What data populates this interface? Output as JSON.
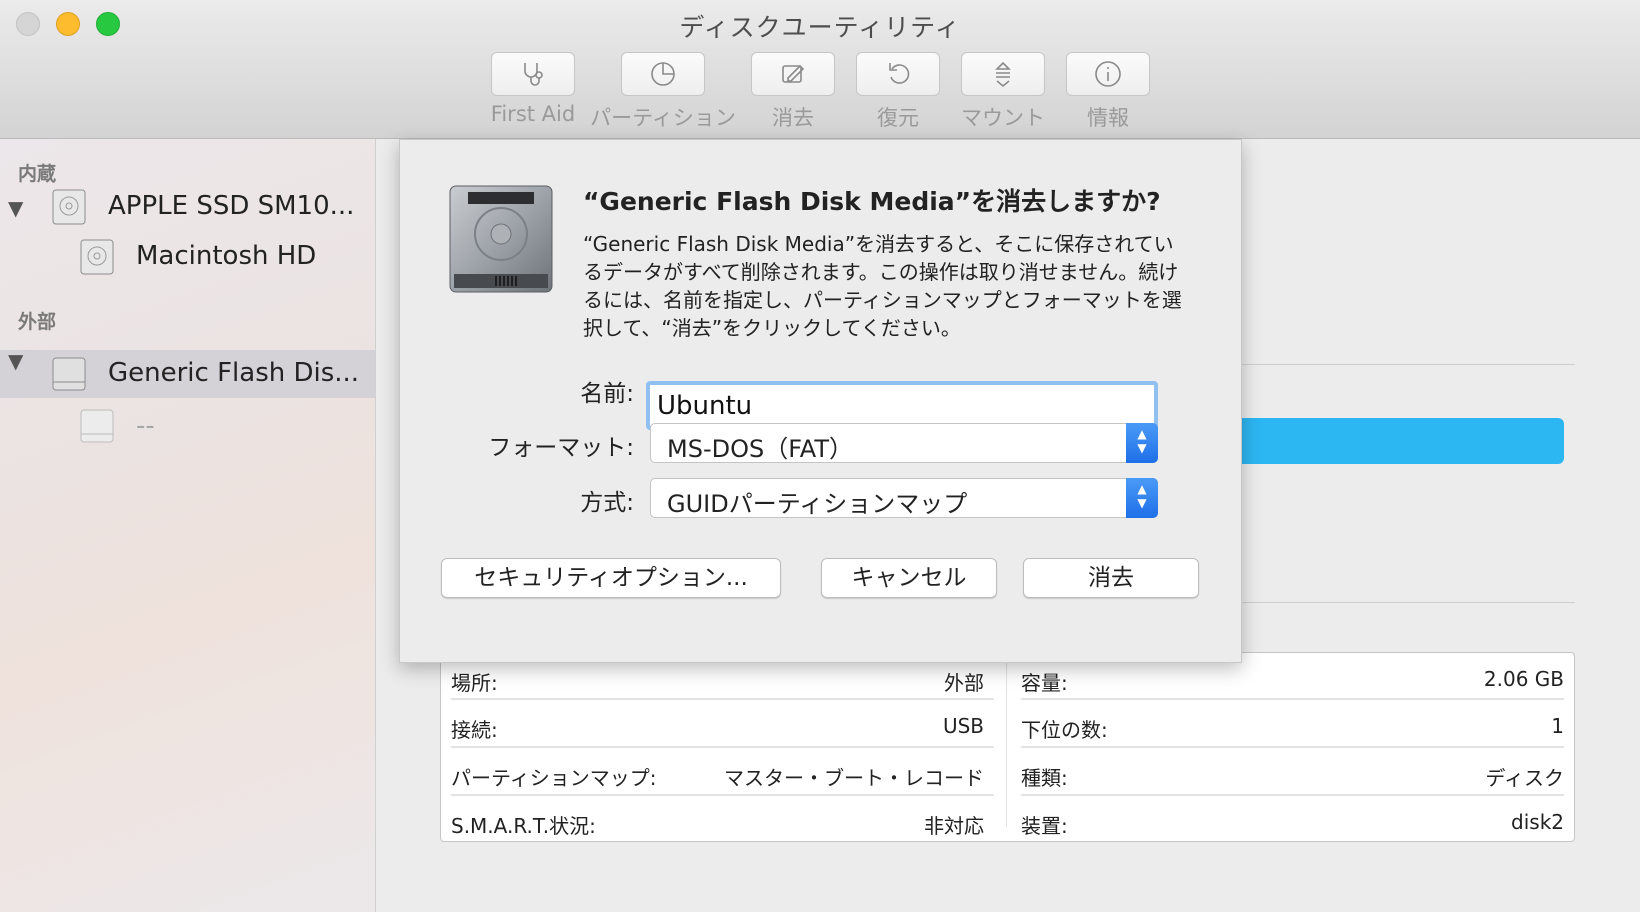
{
  "window": {
    "title": "ディスクユーティリティ"
  },
  "toolbar": [
    {
      "label": "First Aid",
      "icon": "stethoscope-icon"
    },
    {
      "label": "パーティション",
      "icon": "pie-chart-icon"
    },
    {
      "label": "消去",
      "icon": "erase-icon"
    },
    {
      "label": "復元",
      "icon": "restore-icon"
    },
    {
      "label": "マウント",
      "icon": "mount-icon"
    },
    {
      "label": "情報",
      "icon": "info-icon"
    }
  ],
  "sidebar": {
    "internal_header": "内蔵",
    "internal_disk": "APPLE SSD SM10...",
    "internal_volume": "Macintosh HD",
    "external_header": "外部",
    "external_disk": "Generic Flash Dis...",
    "external_volume": "--"
  },
  "dialog": {
    "title": "“Generic Flash Disk Media”を消去しますか?",
    "message": "“Generic Flash Disk Media”を消去すると、そこに保存されているデータがすべて削除されます。この操作は取り消せません。続けるには、名前を指定し、パーティションマップとフォーマットを選択して、“消去”をクリックしてください。",
    "name_label": "名前:",
    "name_value": "Ubuntu",
    "format_label": "フォーマット:",
    "format_value": "MS-DOS（FAT）",
    "scheme_label": "方式:",
    "scheme_value": "GUIDパーティションマップ",
    "security_button": "セキュリティオプション...",
    "cancel_button": "キャンセル",
    "erase_button": "消去"
  },
  "info": {
    "left": [
      {
        "key": "場所:",
        "value": "外部"
      },
      {
        "key": "接続:",
        "value": "USB"
      },
      {
        "key": "パーティションマップ:",
        "value": "マスター・ブート・レコード"
      },
      {
        "key": "S.M.A.R.T.状況:",
        "value": "非対応"
      }
    ],
    "right": [
      {
        "key": "容量:",
        "value": "2.06 GB"
      },
      {
        "key": "下位の数:",
        "value": "1"
      },
      {
        "key": "種類:",
        "value": "ディスク"
      },
      {
        "key": "装置:",
        "value": "disk2"
      }
    ]
  },
  "colors": {
    "accent": "#2cb6f2",
    "select_stepper": "#1f6fe8",
    "focus_ring": "#8fc0f0"
  }
}
